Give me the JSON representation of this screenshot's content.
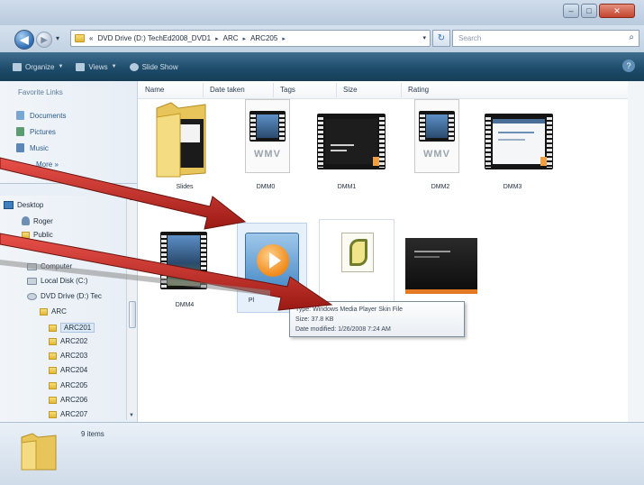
{
  "window": {
    "controls": {
      "minimize": "–",
      "maximize": "□",
      "close": "✕"
    }
  },
  "nav": {
    "back_icon": "back-arrow-icon",
    "forward_icon": "forward-arrow-icon",
    "breadcrumb": [
      "«",
      "DVD Drive (D:) TechEd2008_DVD1",
      "ARC",
      "ARC205"
    ],
    "refresh_symbol": "↻",
    "search_placeholder": "Search"
  },
  "toolbar": {
    "items": [
      "Organize",
      "Views",
      "Slide Show"
    ]
  },
  "sidebar": {
    "favorites_header": "Favorite Links",
    "favorites": [
      "Documents",
      "Pictures",
      "Music"
    ],
    "more": "More »",
    "folders_caret": "⌄",
    "tree": [
      {
        "label": "Desktop"
      },
      {
        "label": "Roger"
      },
      {
        "label": "Public"
      },
      {
        "label": "Computer"
      },
      {
        "label": "Local Disk (C:)"
      },
      {
        "label": "DVD Drive (D:) Tec"
      },
      {
        "label": "ARC"
      },
      {
        "label": "ARC201"
      },
      {
        "label": "ARC202"
      },
      {
        "label": "ARC203"
      },
      {
        "label": "ARC204"
      },
      {
        "label": "ARC205"
      },
      {
        "label": "ARC206"
      },
      {
        "label": "ARC207"
      }
    ]
  },
  "columns": [
    "Name",
    "Date taken",
    "Tags",
    "Size",
    "Rating"
  ],
  "files": [
    {
      "label": "Slides",
      "kind": "folder"
    },
    {
      "label": "DMM0",
      "kind": "wmv"
    },
    {
      "label": "DMM1",
      "kind": "video-dark"
    },
    {
      "label": "DMM2",
      "kind": "wmv"
    },
    {
      "label": "DMM3",
      "kind": "video-screen"
    },
    {
      "label": "DMM4",
      "kind": "video-photo"
    },
    {
      "label": "Pl",
      "kind": "media-player-skin",
      "selected": true
    },
    {
      "label": "",
      "kind": "script"
    },
    {
      "label": "",
      "kind": "video-orange"
    }
  ],
  "tooltip": {
    "type_line": "Type: Windows Media Player Skin File",
    "size_line": "Size: 37.8 KB",
    "modified_line": "Date modified: 1/26/2008 7:24 AM"
  },
  "details": {
    "item_count": "9 items"
  },
  "colors": {
    "toolbar": "#1c4a69",
    "arrow": "#c0251f",
    "accent": "#2b70b8"
  }
}
